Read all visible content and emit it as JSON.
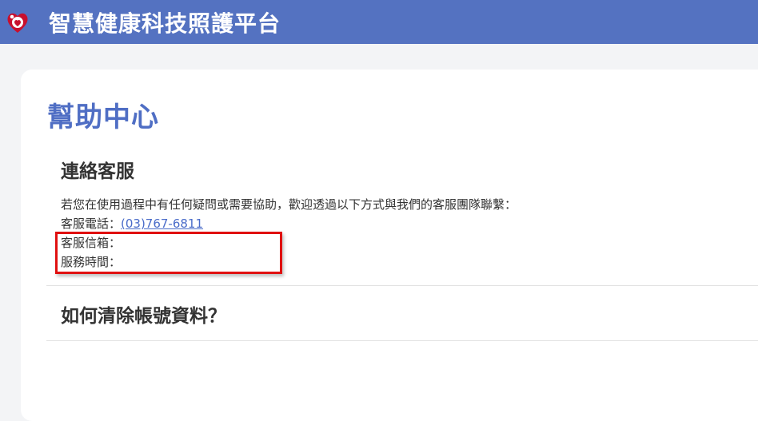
{
  "header": {
    "title": "智慧健康科技照護平台",
    "logo_icon": "heart-care-logo-icon",
    "bg_color": "#5472c1"
  },
  "main": {
    "page_title": "幫助中心",
    "contact": {
      "heading": "連絡客服",
      "intro": "若您在使用過程中有任何疑問或需要協助，歡迎透過以下方式與我們的客服團隊聯繫：",
      "phone_label": "客服電話：",
      "phone_value": "(03)767-6811",
      "email_label": "客服信箱：",
      "hours_label": "服務時間："
    },
    "faq": {
      "heading": "如何清除帳號資料？"
    }
  },
  "colors": {
    "accent": "#4f6ec4",
    "link": "#4a6cc9",
    "highlight": "#e01010"
  }
}
